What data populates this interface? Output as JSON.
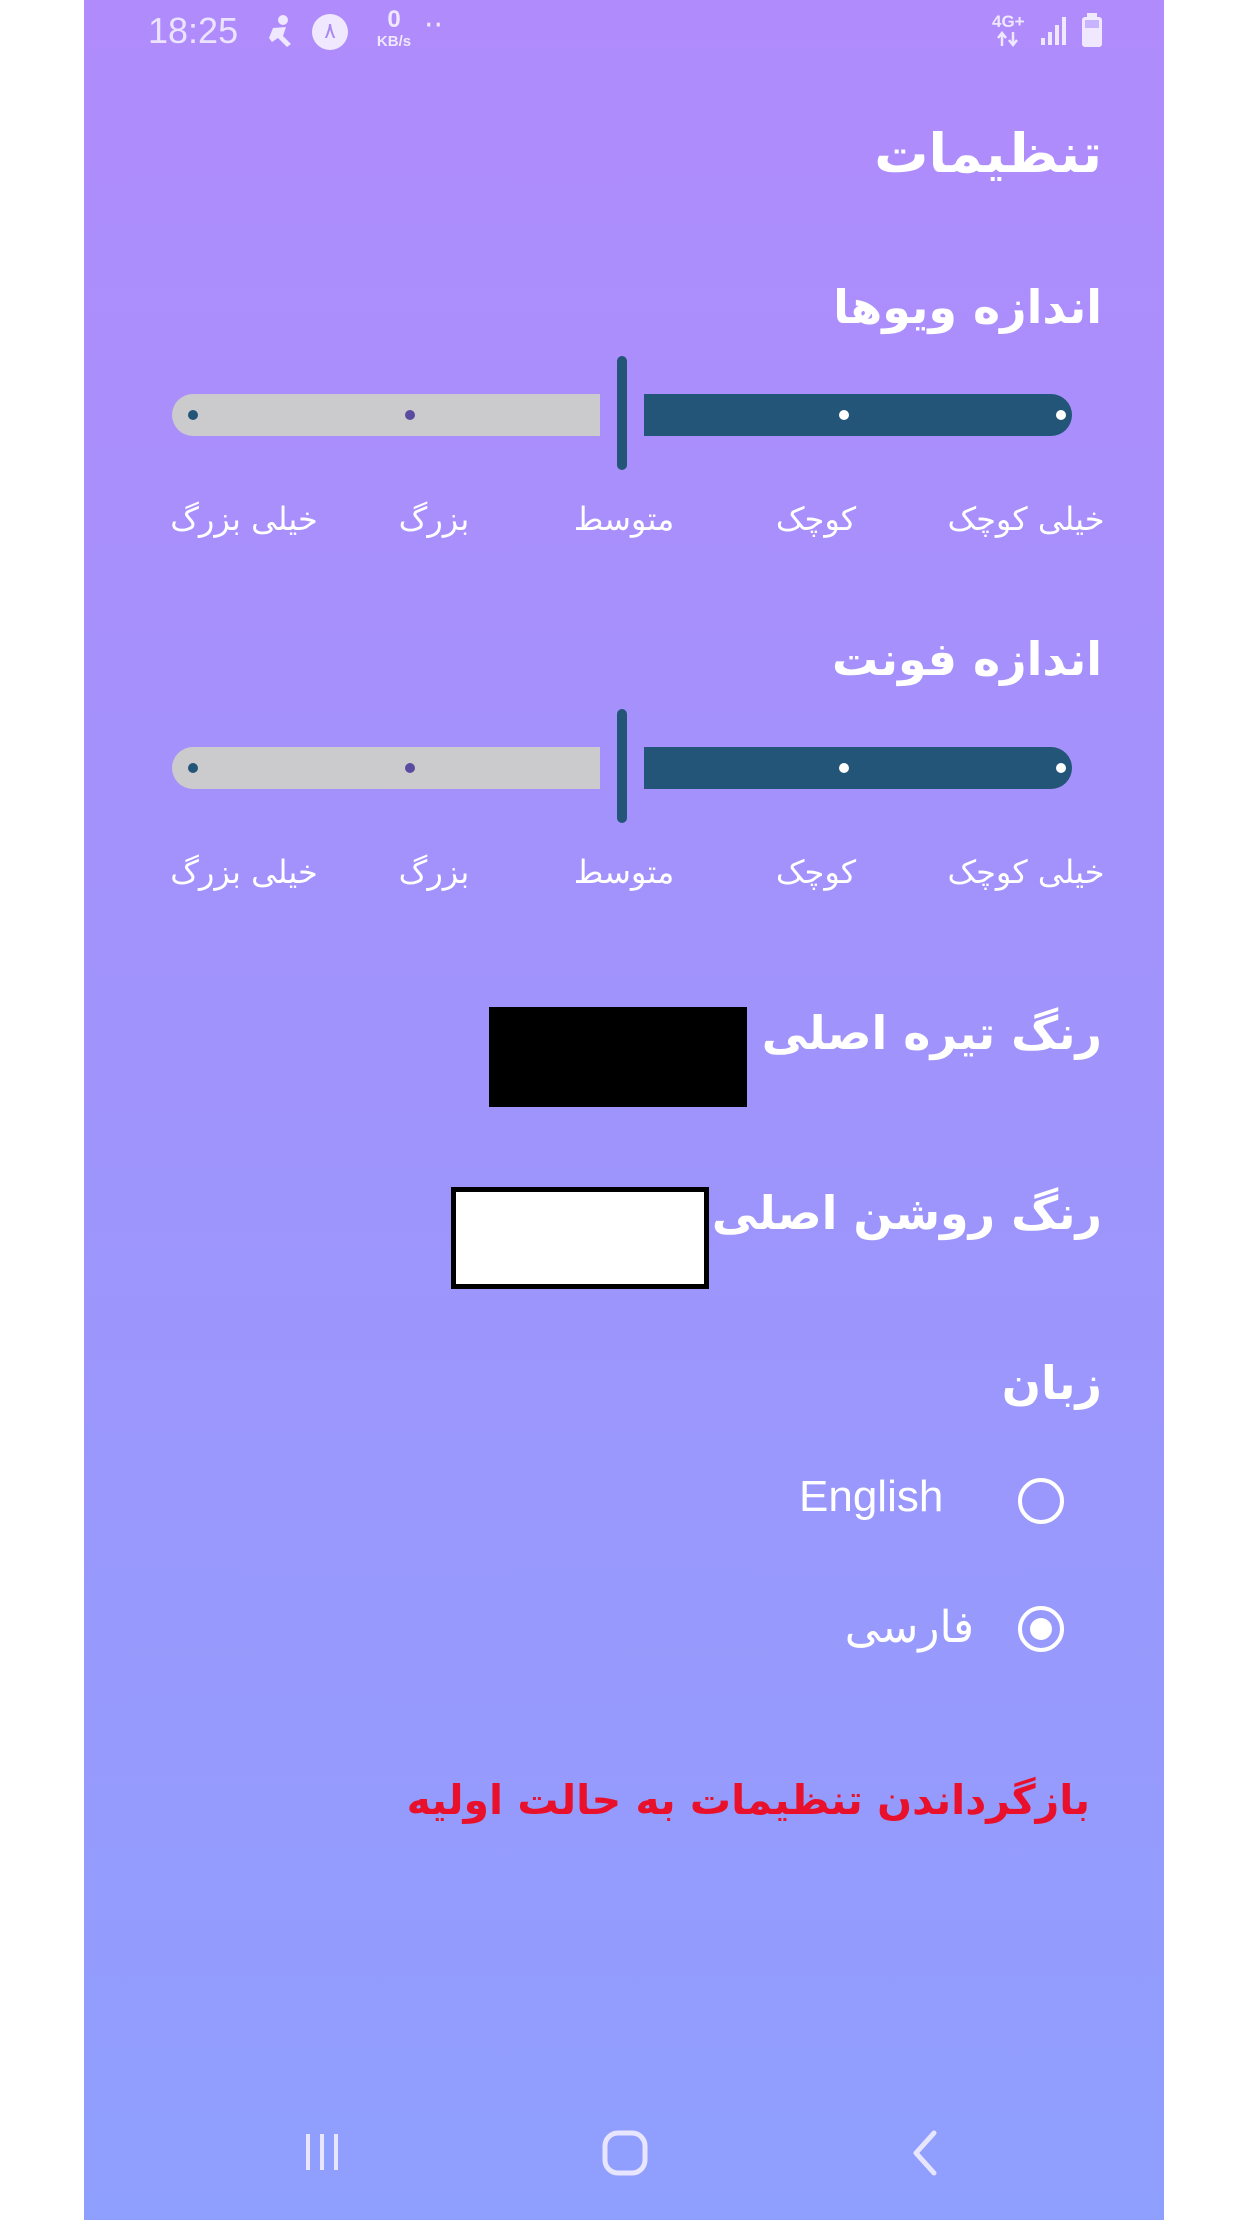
{
  "status_bar": {
    "time": "18:25",
    "badge_digit": "۸",
    "data_rate_value": "0",
    "data_rate_unit": "KB/s",
    "overflow": "··",
    "network": "4G+"
  },
  "title": "تنظیمات",
  "view_size": {
    "heading": "اندازه ویوها",
    "labels": [
      "خیلی کوچک",
      "کوچک",
      "متوسط",
      "بزرگ",
      "خیلی بزرگ"
    ],
    "selected": "متوسط"
  },
  "font_size": {
    "heading": "اندازه فونت",
    "labels": [
      "خیلی کوچک",
      "کوچک",
      "متوسط",
      "بزرگ",
      "خیلی بزرگ"
    ],
    "selected": "متوسط"
  },
  "colors": {
    "dark_label": "رنگ تیره اصلی",
    "dark_value": "#000000",
    "light_label": "رنگ روشن اصلی",
    "light_value": "#ffffff",
    "track_active": "#225577",
    "track_inactive": "#cbcbcd",
    "reset_text_color": "#e8102a"
  },
  "language": {
    "heading": "زبان",
    "options": [
      {
        "label": "English",
        "checked": false
      },
      {
        "label": "فارسی",
        "checked": true
      }
    ]
  },
  "reset_label": "بازگرداندن تنظیمات به حالت اولیه",
  "nav_bar": {
    "recents_icon": "recents-icon",
    "home_icon": "home-icon",
    "back_icon": "back-icon"
  }
}
